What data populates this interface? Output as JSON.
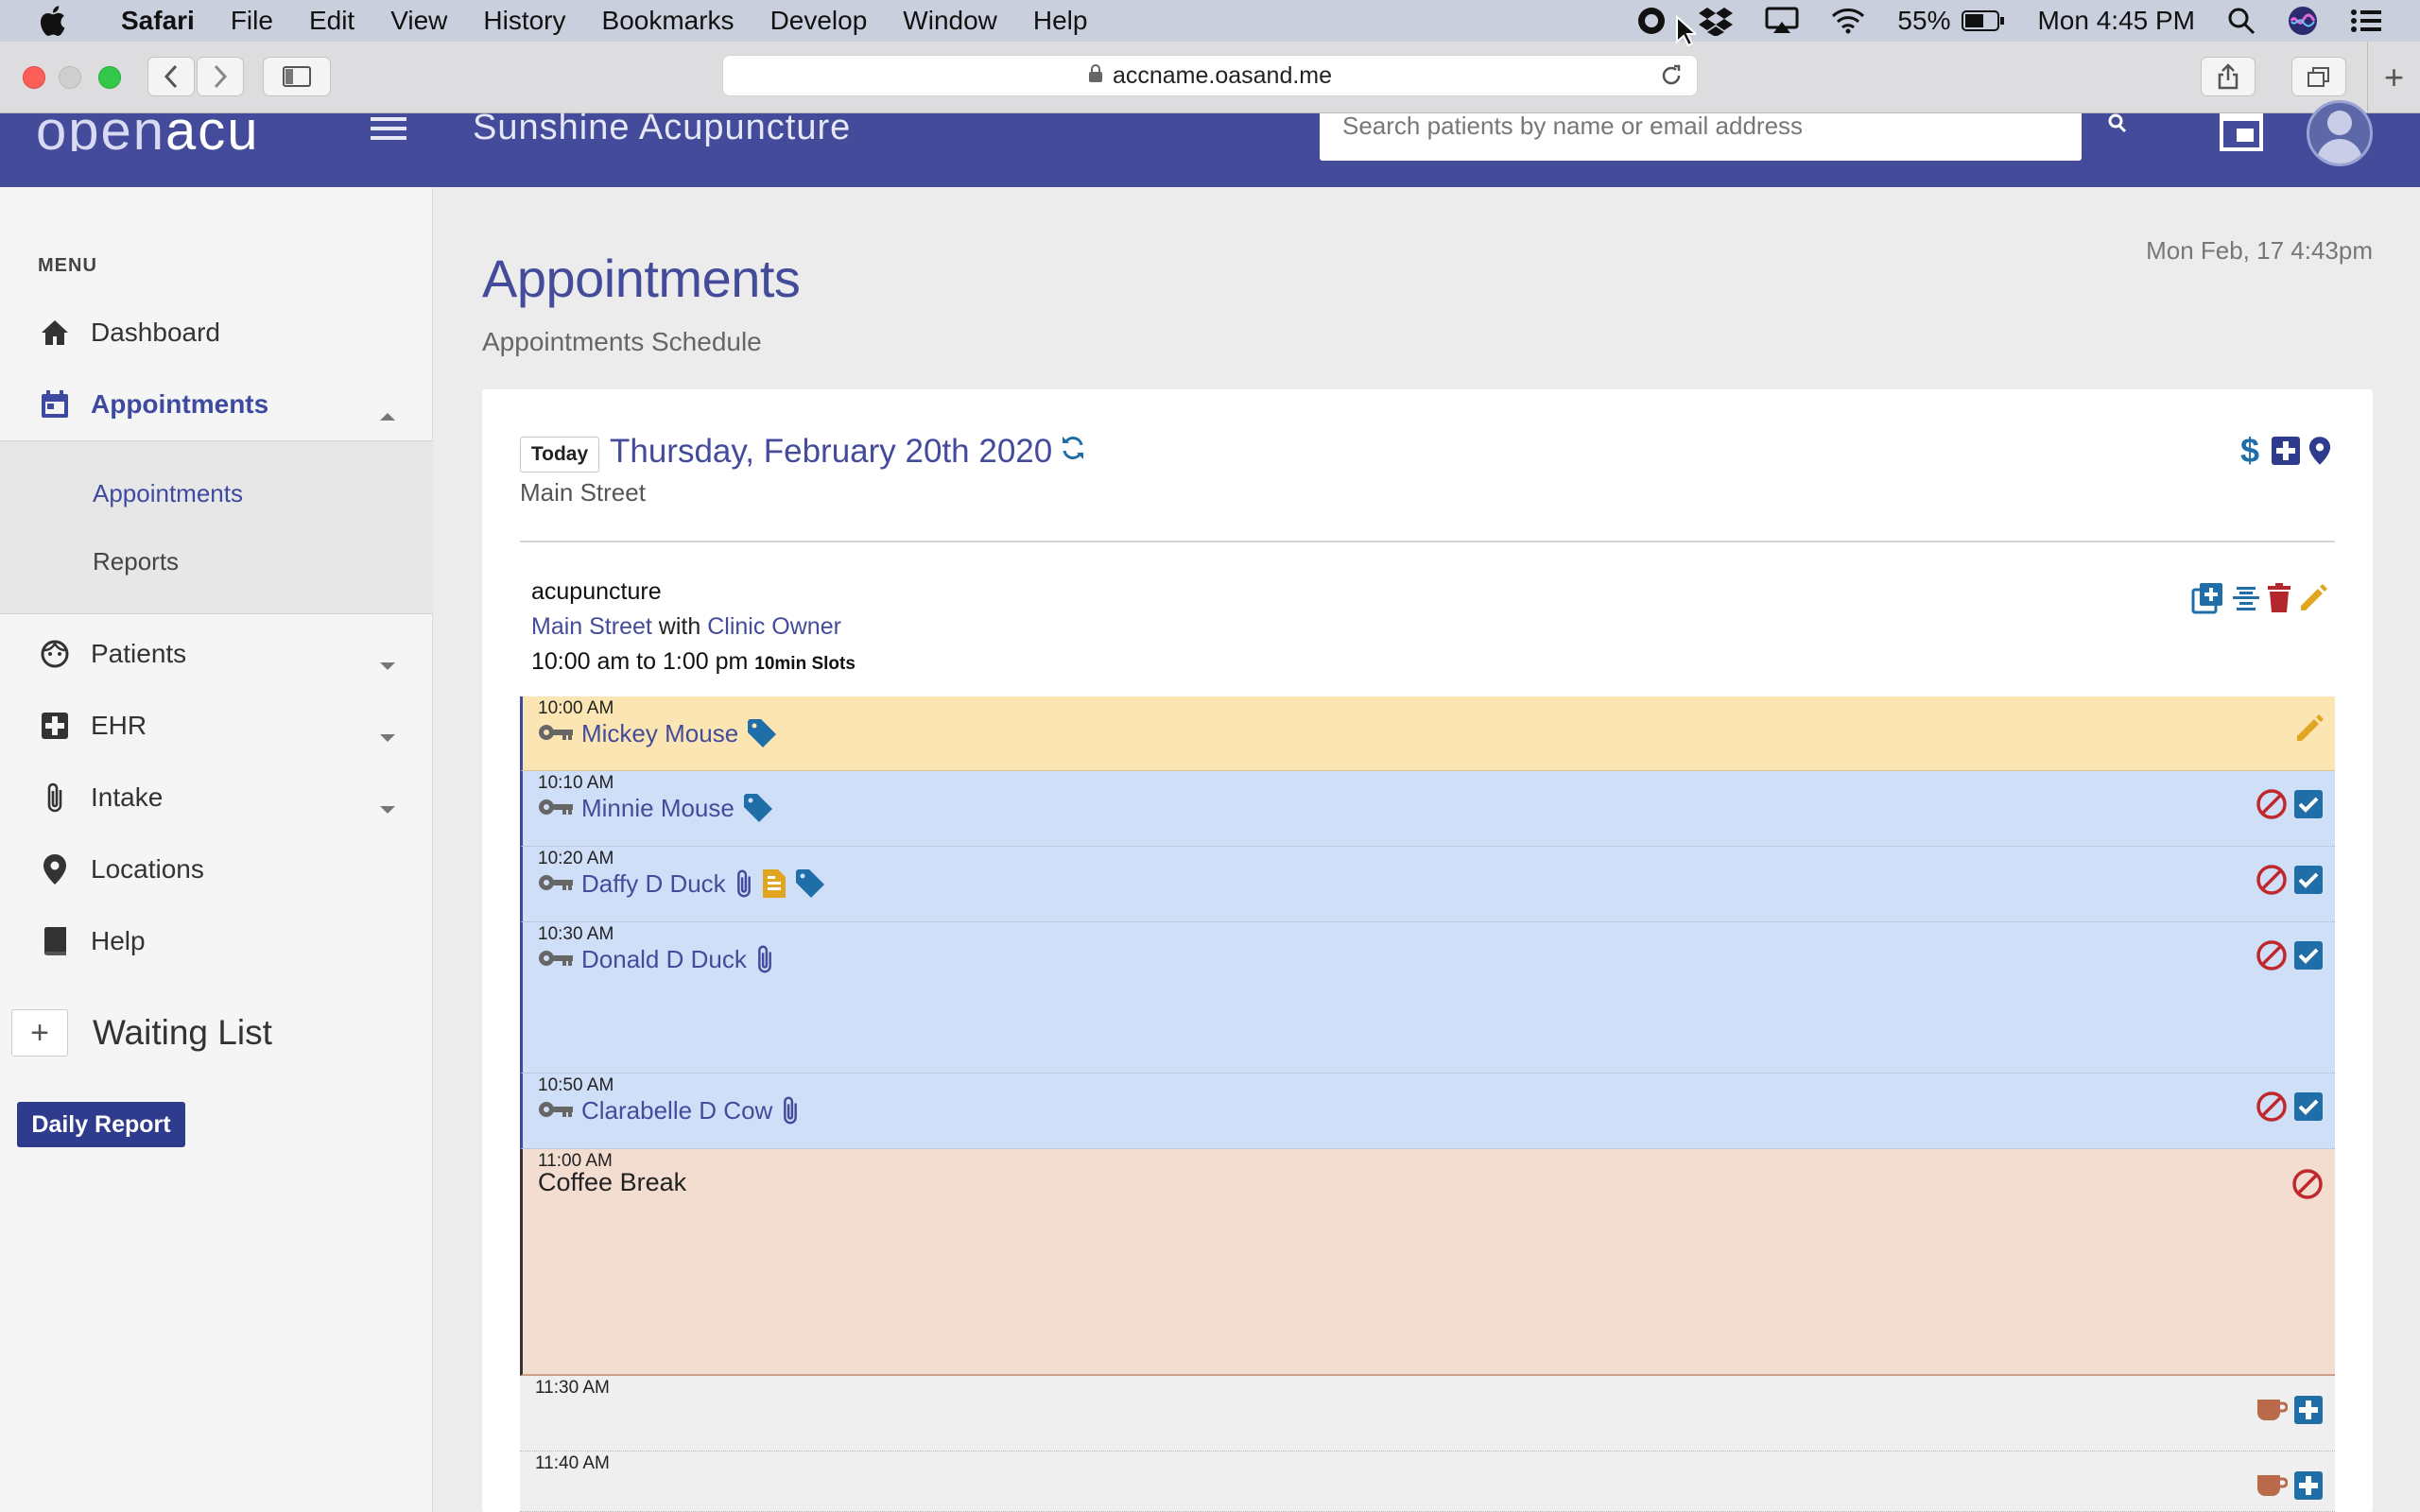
{
  "menubar": {
    "app": "Safari",
    "menus": [
      "File",
      "Edit",
      "View",
      "History",
      "Bookmarks",
      "Develop",
      "Window",
      "Help"
    ],
    "battery": "55%",
    "clock": "Mon 4:45 PM"
  },
  "browser": {
    "url": "accname.oasand.me"
  },
  "header": {
    "logo_part1": "open",
    "logo_part2": "acu",
    "clinic_name": "Sunshine Acupuncture",
    "search_placeholder": "Search patients by name or email address"
  },
  "sidebar": {
    "menu_label": "MENU",
    "items": [
      {
        "label": "Dashboard",
        "icon": "home-icon"
      },
      {
        "label": "Appointments",
        "icon": "calendar-icon",
        "active": true
      },
      {
        "label": "Patients",
        "icon": "face-icon"
      },
      {
        "label": "EHR",
        "icon": "medical-plus-icon"
      },
      {
        "label": "Intake",
        "icon": "paperclip-icon"
      },
      {
        "label": "Locations",
        "icon": "map-pin-icon"
      },
      {
        "label": "Help",
        "icon": "book-icon"
      }
    ],
    "submenu": [
      "Appointments",
      "Reports"
    ],
    "waiting_list": "Waiting List",
    "daily_report": "Daily Report"
  },
  "main": {
    "title": "Appointments",
    "subtitle": "Appointments Schedule",
    "datetime": "Mon Feb, 17 4:43pm",
    "today_button": "Today",
    "date_heading": "Thursday, February 20th 2020",
    "location": "Main Street"
  },
  "block": {
    "title": "acupuncture",
    "location": "Main Street",
    "with": "with",
    "practitioner": "Clinic Owner",
    "hours": "10:00 am to 1:00 pm",
    "slot_size": "10min Slots"
  },
  "slots": [
    {
      "time": "10:00 AM",
      "patient": "Mickey Mouse"
    },
    {
      "time": "10:10 AM",
      "patient": "Minnie Mouse"
    },
    {
      "time": "10:20 AM",
      "patient": "Daffy D Duck"
    },
    {
      "time": "10:30 AM",
      "patient": "Donald D Duck"
    },
    {
      "time": "10:50 AM",
      "patient": "Clarabelle D Cow"
    },
    {
      "time": "11:00 AM",
      "patient": "Coffee Break"
    },
    {
      "time": "11:30 AM"
    },
    {
      "time": "11:40 AM"
    }
  ],
  "colors": {
    "brand": "#434b9a",
    "booked": "#cfdff8",
    "current": "#fbe6b3",
    "break": "#f3ddd0",
    "cancel": "#c0282d",
    "edit": "#e0a521",
    "confirm": "#1f6ea8"
  }
}
